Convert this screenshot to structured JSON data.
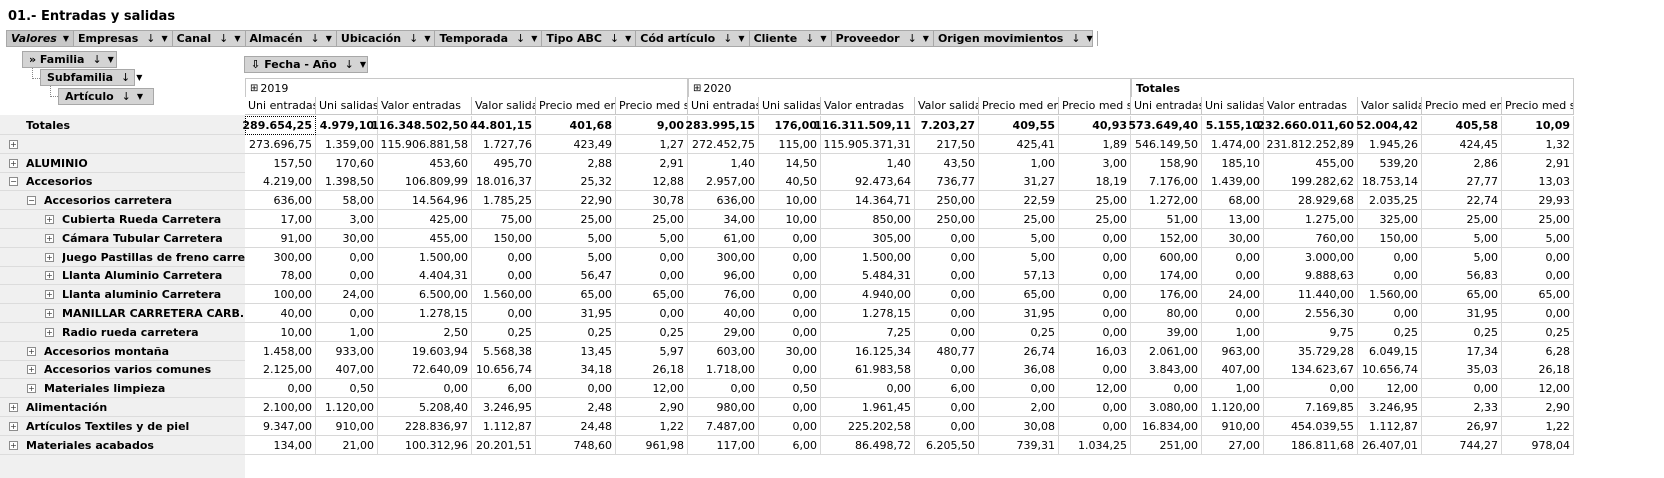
{
  "title": "01.- Entradas y salidas",
  "topbar": [
    {
      "label": "Valores",
      "selected": true
    },
    {
      "label": "Empresas"
    },
    {
      "label": "Canal"
    },
    {
      "label": "Almacén"
    },
    {
      "label": "Ubicación"
    },
    {
      "label": "Temporada"
    },
    {
      "label": "Tipo ABC"
    },
    {
      "label": "Cód artículo"
    },
    {
      "label": "Cliente"
    },
    {
      "label": "Proveedor"
    },
    {
      "label": "Origen movimientos"
    }
  ],
  "row_fields": [
    "» Familia",
    "Subfamilia",
    "Artículo"
  ],
  "col_field": "Fecha - Año",
  "years": [
    "2019",
    "2020",
    "Totales"
  ],
  "columns": [
    "Uni entradas",
    "Uni salidas",
    "Valor entradas",
    "Valor salidas",
    "Precio med entr",
    "Precio med sal"
  ],
  "rows": [
    {
      "label": "Totales",
      "level": 0,
      "bold": true,
      "values": [
        "289.654,25",
        "4.979,10",
        "116.348.502,50",
        "44.801,15",
        "401,68",
        "9,00",
        "283.995,15",
        "176,00",
        "116.311.509,11",
        "7.203,27",
        "409,55",
        "40,93",
        "573.649,40",
        "5.155,10",
        "232.660.011,60",
        "52.004,42",
        "405,58",
        "10,09"
      ]
    },
    {
      "label": "",
      "level": 0,
      "values": [
        "273.696,75",
        "1.359,00",
        "115.906.881,58",
        "1.727,76",
        "423,49",
        "1,27",
        "272.452,75",
        "115,00",
        "115.905.371,31",
        "217,50",
        "425,41",
        "1,89",
        "546.149,50",
        "1.474,00",
        "231.812.252,89",
        "1.945,26",
        "424,45",
        "1,32"
      ]
    },
    {
      "label": "ALUMINIO",
      "level": 0,
      "values": [
        "157,50",
        "170,60",
        "453,60",
        "495,70",
        "2,88",
        "2,91",
        "1,40",
        "14,50",
        "1,40",
        "43,50",
        "1,00",
        "3,00",
        "158,90",
        "185,10",
        "455,00",
        "539,20",
        "2,86",
        "2,91"
      ]
    },
    {
      "label": "Accesorios",
      "level": 0,
      "expanded": true,
      "values": [
        "4.219,00",
        "1.398,50",
        "106.809,99",
        "18.016,37",
        "25,32",
        "12,88",
        "2.957,00",
        "40,50",
        "92.473,64",
        "736,77",
        "31,27",
        "18,19",
        "7.176,00",
        "1.439,00",
        "199.282,62",
        "18.753,14",
        "27,77",
        "13,03"
      ]
    },
    {
      "label": "Accesorios carretera",
      "level": 1,
      "expanded": true,
      "values": [
        "636,00",
        "58,00",
        "14.564,96",
        "1.785,25",
        "22,90",
        "30,78",
        "636,00",
        "10,00",
        "14.364,71",
        "250,00",
        "22,59",
        "25,00",
        "1.272,00",
        "68,00",
        "28.929,68",
        "2.035,25",
        "22,74",
        "29,93"
      ]
    },
    {
      "label": "Cubierta Rueda Carretera",
      "level": 2,
      "values": [
        "17,00",
        "3,00",
        "425,00",
        "75,00",
        "25,00",
        "25,00",
        "34,00",
        "10,00",
        "850,00",
        "250,00",
        "25,00",
        "25,00",
        "51,00",
        "13,00",
        "1.275,00",
        "325,00",
        "25,00",
        "25,00"
      ]
    },
    {
      "label": "Cámara Tubular Carretera",
      "level": 2,
      "values": [
        "91,00",
        "30,00",
        "455,00",
        "150,00",
        "5,00",
        "5,00",
        "61,00",
        "0,00",
        "305,00",
        "0,00",
        "5,00",
        "0,00",
        "152,00",
        "30,00",
        "760,00",
        "150,00",
        "5,00",
        "5,00"
      ]
    },
    {
      "label": "Juego Pastillas de freno carre...",
      "level": 2,
      "values": [
        "300,00",
        "0,00",
        "1.500,00",
        "0,00",
        "5,00",
        "0,00",
        "300,00",
        "0,00",
        "1.500,00",
        "0,00",
        "5,00",
        "0,00",
        "600,00",
        "0,00",
        "3.000,00",
        "0,00",
        "5,00",
        "0,00"
      ]
    },
    {
      "label": "Llanta Aluminio Carretera",
      "level": 2,
      "values": [
        "78,00",
        "0,00",
        "4.404,31",
        "0,00",
        "56,47",
        "0,00",
        "96,00",
        "0,00",
        "5.484,31",
        "0,00",
        "57,13",
        "0,00",
        "174,00",
        "0,00",
        "9.888,63",
        "0,00",
        "56,83",
        "0,00"
      ]
    },
    {
      "label": "Llanta aluminio Carretera",
      "level": 2,
      "values": [
        "100,00",
        "24,00",
        "6.500,00",
        "1.560,00",
        "65,00",
        "65,00",
        "76,00",
        "0,00",
        "4.940,00",
        "0,00",
        "65,00",
        "0,00",
        "176,00",
        "24,00",
        "11.440,00",
        "1.560,00",
        "65,00",
        "65,00"
      ]
    },
    {
      "label": "MANILLAR CARRETERA CARB...",
      "level": 2,
      "values": [
        "40,00",
        "0,00",
        "1.278,15",
        "0,00",
        "31,95",
        "0,00",
        "40,00",
        "0,00",
        "1.278,15",
        "0,00",
        "31,95",
        "0,00",
        "80,00",
        "0,00",
        "2.556,30",
        "0,00",
        "31,95",
        "0,00"
      ]
    },
    {
      "label": "Radio rueda carretera",
      "level": 2,
      "values": [
        "10,00",
        "1,00",
        "2,50",
        "0,25",
        "0,25",
        "0,25",
        "29,00",
        "0,00",
        "7,25",
        "0,00",
        "0,25",
        "0,00",
        "39,00",
        "1,00",
        "9,75",
        "0,25",
        "0,25",
        "0,25"
      ]
    },
    {
      "label": "Accesorios montaña",
      "level": 1,
      "values": [
        "1.458,00",
        "933,00",
        "19.603,94",
        "5.568,38",
        "13,45",
        "5,97",
        "603,00",
        "30,00",
        "16.125,34",
        "480,77",
        "26,74",
        "16,03",
        "2.061,00",
        "963,00",
        "35.729,28",
        "6.049,15",
        "17,34",
        "6,28"
      ]
    },
    {
      "label": "Accesorios varios comunes",
      "level": 1,
      "values": [
        "2.125,00",
        "407,00",
        "72.640,09",
        "10.656,74",
        "34,18",
        "26,18",
        "1.718,00",
        "0,00",
        "61.983,58",
        "0,00",
        "36,08",
        "0,00",
        "3.843,00",
        "407,00",
        "134.623,67",
        "10.656,74",
        "35,03",
        "26,18"
      ]
    },
    {
      "label": "Materiales limpieza",
      "level": 1,
      "values": [
        "0,00",
        "0,50",
        "0,00",
        "6,00",
        "0,00",
        "12,00",
        "0,00",
        "0,50",
        "0,00",
        "6,00",
        "0,00",
        "12,00",
        "0,00",
        "1,00",
        "0,00",
        "12,00",
        "0,00",
        "12,00"
      ]
    },
    {
      "label": "Alimentación",
      "level": 0,
      "values": [
        "2.100,00",
        "1.120,00",
        "5.208,40",
        "3.246,95",
        "2,48",
        "2,90",
        "980,00",
        "0,00",
        "1.961,45",
        "0,00",
        "2,00",
        "0,00",
        "3.080,00",
        "1.120,00",
        "7.169,85",
        "3.246,95",
        "2,33",
        "2,90"
      ]
    },
    {
      "label": "Artículos Textiles y de piel",
      "level": 0,
      "values": [
        "9.347,00",
        "910,00",
        "228.836,97",
        "1.112,87",
        "24,48",
        "1,22",
        "7.487,00",
        "0,00",
        "225.202,58",
        "0,00",
        "30,08",
        "0,00",
        "16.834,00",
        "910,00",
        "454.039,55",
        "1.112,87",
        "26,97",
        "1,22"
      ]
    },
    {
      "label": "Materiales acabados",
      "level": 0,
      "values": [
        "134,00",
        "21,00",
        "100.312,96",
        "20.201,51",
        "748,60",
        "961,98",
        "117,00",
        "6,00",
        "86.498,72",
        "6.205,50",
        "739,31",
        "1.034,25",
        "251,00",
        "27,00",
        "186.811,68",
        "26.407,01",
        "744,27",
        "978,04"
      ]
    }
  ]
}
